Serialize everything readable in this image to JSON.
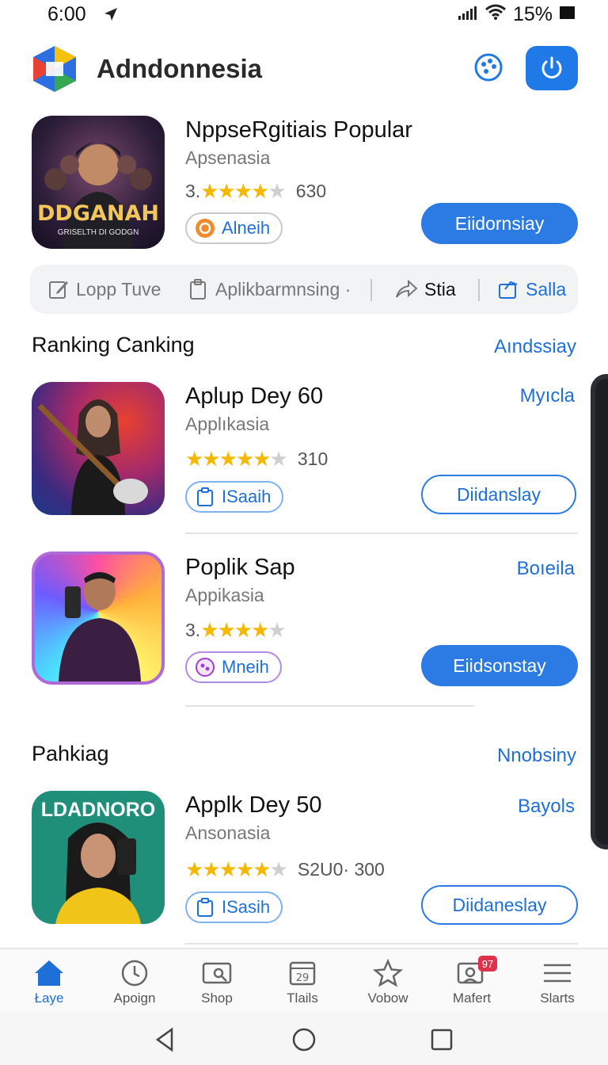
{
  "status_bar": {
    "time": "6:00",
    "battery": "15%"
  },
  "header": {
    "title": "Adndonnesia"
  },
  "featured": {
    "name": "NppseRgitiais Popular",
    "subtitle": "Apsenasia",
    "rating_prefix": "3.",
    "rating_stars": 4,
    "rating_count": "630",
    "chip_label": "Alneih",
    "button_label": "Eiidornsiay",
    "thumb_text": "DDGANAH",
    "thumb_subtext": "GRISELTH DI GODGN"
  },
  "actions": [
    {
      "label": "Lopp Tuve",
      "icon": "edit-icon"
    },
    {
      "label": "Aplikbarmnsing ·",
      "icon": "clipboard-icon"
    },
    {
      "label": "Stia",
      "icon": "share-icon"
    },
    {
      "label": "Salla",
      "icon": "bookmark-icon"
    }
  ],
  "ranking_section": {
    "title": "Ranking Canking",
    "link": "Aındssiay",
    "items": [
      {
        "name": "Aplup Dey 60",
        "subtitle": "Applıkasia",
        "rating_prefix": "",
        "rating_stars": 5,
        "rating_count": "310",
        "chip_label": "ISaaih",
        "button_label": "Diidanslay",
        "button_style": "outline",
        "side_link": "Myıcla"
      },
      {
        "name": "Poplik Sap",
        "subtitle": "Appikasia",
        "rating_prefix": "3.",
        "rating_stars": 4,
        "rating_count": "",
        "chip_label": "Mneih",
        "button_label": "Eiidsonstay",
        "button_style": "solid",
        "side_link": "Boıeila"
      }
    ]
  },
  "pankiag_section": {
    "title": "Pahkiag",
    "link": "Nnobsiny",
    "items": [
      {
        "name": "Applk Dey 50",
        "subtitle": "Ansonasia",
        "rating_prefix": "",
        "rating_stars": 5,
        "rating_count": "S2U0· 300",
        "chip_label": "ISasih",
        "button_label": "Diidaneslay",
        "button_style": "outline",
        "side_link": "Bayols",
        "thumb_text": "LDADNORO"
      }
    ]
  },
  "bottom_nav": [
    {
      "label": "Łaye",
      "icon": "home-icon",
      "active": true
    },
    {
      "label": "Apoign",
      "icon": "clock-icon",
      "active": false
    },
    {
      "label": "Shop",
      "icon": "shop-icon",
      "active": false
    },
    {
      "label": "Tlails",
      "icon": "calendar-icon",
      "active": false,
      "icon_text": "29"
    },
    {
      "label": "Vobow",
      "icon": "star-icon",
      "active": false
    },
    {
      "label": "Mafert",
      "icon": "chat-icon",
      "active": false,
      "badge": "97"
    },
    {
      "label": "Slarts",
      "icon": "menu-icon",
      "active": false
    }
  ],
  "colors": {
    "accent": "#2c7be5",
    "star": "#f5b800"
  }
}
